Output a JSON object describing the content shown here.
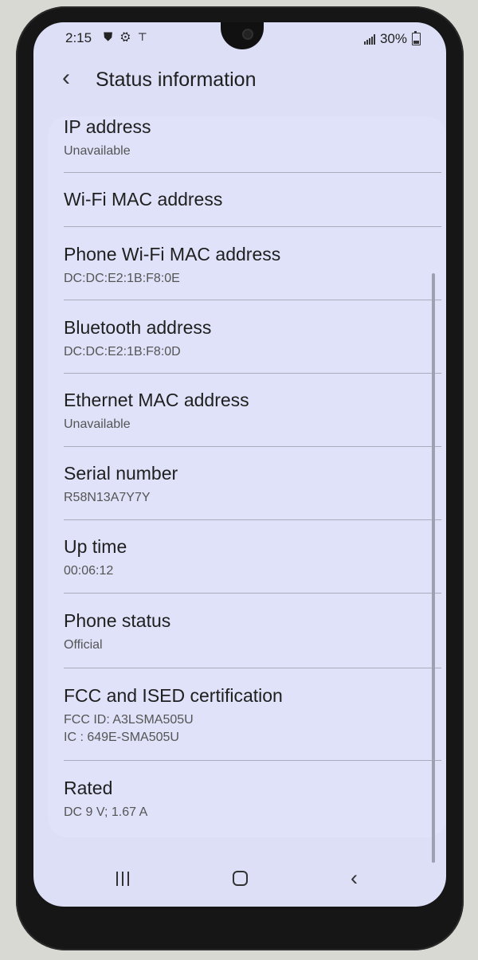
{
  "status_bar": {
    "time": "2:15",
    "status_icons": "⛊ ⚙ ⊤",
    "battery_text": "30%"
  },
  "app_bar": {
    "back_icon": "‹",
    "title": "Status information"
  },
  "items": [
    {
      "title": "IP address",
      "subtitle": "Unavailable"
    },
    {
      "title": "Wi-Fi MAC address",
      "subtitle": ""
    },
    {
      "title": "Phone Wi-Fi MAC address",
      "subtitle": "DC:DC:E2:1B:F8:0E"
    },
    {
      "title": "Bluetooth address",
      "subtitle": "DC:DC:E2:1B:F8:0D"
    },
    {
      "title": "Ethernet MAC address",
      "subtitle": "Unavailable"
    },
    {
      "title": "Serial number",
      "subtitle": "R58N13A7Y7Y"
    },
    {
      "title": "Up time",
      "subtitle": "00:06:12"
    },
    {
      "title": "Phone status",
      "subtitle": "Official"
    },
    {
      "title": "FCC and ISED certification",
      "subtitle": "FCC ID: A3LSMA505U",
      "subtitle2": "IC : 649E-SMA505U"
    },
    {
      "title": "Rated",
      "subtitle": "DC 9 V; 1.67 A"
    }
  ],
  "navigation": {
    "back_icon": "‹"
  }
}
